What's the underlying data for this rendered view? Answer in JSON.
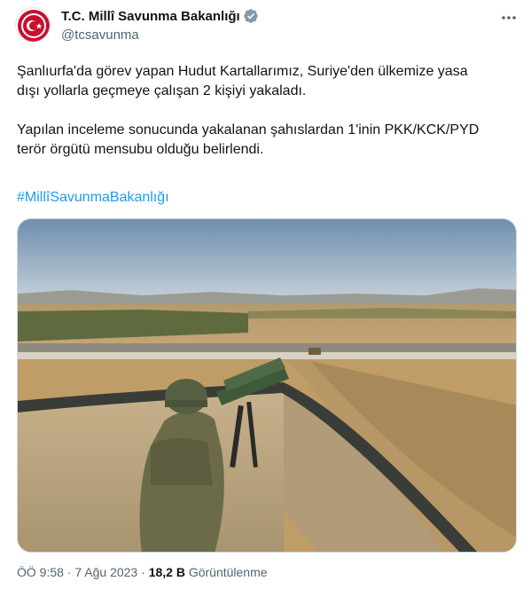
{
  "account": {
    "display_name": "T.C. Millî Savunma Bakanlığı",
    "handle": "@tcsavunma",
    "verified_color": "#829aab"
  },
  "tweet": {
    "paragraphs": [
      "Şanlıurfa'da görev yapan Hudut Kartallarımız, Suriye'den ülkemize yasa\ndışı yollarla geçmeye çalışan 2 kişiyi yakaladı.",
      "Yapılan inceleme sonucunda yakalanan şahıslardan 1'inin PKK/KCK/PYD\nterör örgütü mensubu olduğu belirlendi."
    ],
    "hashtag": "#MillîSavunmaBakanlığı"
  },
  "meta": {
    "time": "ÖÖ 9:58",
    "separator": " · ",
    "date": "7 Ağu 2023",
    "views_count": "18,2 B",
    "views_label": "Görüntülenme"
  },
  "icons": {
    "more": "more-horizontal-icon",
    "verified": "verified-badge-icon",
    "avatar": "ministry-emblem"
  },
  "colors": {
    "link": "#1d9bf0",
    "secondary": "#536471",
    "text": "#0f1419",
    "emblem_red": "#c8102e"
  }
}
